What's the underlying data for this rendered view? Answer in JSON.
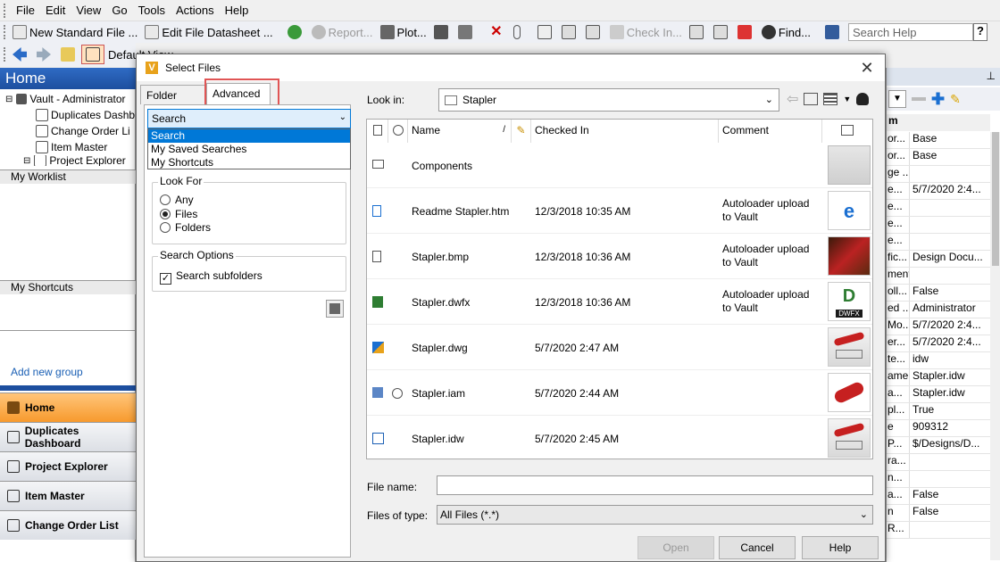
{
  "menu": [
    "File",
    "Edit",
    "View",
    "Go",
    "Tools",
    "Actions",
    "Help"
  ],
  "toolbar1": {
    "new_standard_file": "New Standard File ...",
    "edit_file_datasheet": "Edit File Datasheet ...",
    "report": "Report...",
    "plot": "Plot...",
    "check_in": "Check In...",
    "find": "Find...",
    "search_help_placeholder": "Search Help",
    "help_q": "?"
  },
  "toolbar2": {
    "view_label": "Default View"
  },
  "left_pane": {
    "title": "Home",
    "tree": [
      "Vault - Administrator",
      "Duplicates Dashb",
      "Change Order Li",
      "Item Master",
      "Project Explorer"
    ],
    "my_worklist": "My Worklist",
    "my_shortcuts": "My Shortcuts",
    "add_new_group": "Add new group",
    "nav": [
      "Home",
      "Duplicates Dashboard",
      "Project Explorer",
      "Item Master",
      "Change Order List"
    ]
  },
  "dialog": {
    "title": "Select Files",
    "close": "✕",
    "tabs": [
      "Folder View",
      "Advanced"
    ],
    "search_combo": "Search",
    "search_options_list": [
      "Search",
      "My Saved Searches",
      "My Shortcuts"
    ],
    "look_for": {
      "title": "Look For",
      "options": [
        "Any",
        "Files",
        "Folders"
      ],
      "selected": "Files"
    },
    "search_options": {
      "title": "Search Options",
      "subfolders": "Search subfolders",
      "checked": true
    },
    "look_in_label": "Look in:",
    "look_in_value": "Stapler",
    "columns": [
      "Name",
      "Checked In",
      "Comment"
    ],
    "files": [
      {
        "name": "Components",
        "checked_in": "",
        "comment": [
          "",
          ""
        ],
        "icon": "folder-icon",
        "thumb": "folder"
      },
      {
        "name": "Readme Stapler.htm",
        "checked_in": "12/3/2018 10:35 AM",
        "comment": [
          "Autoloader upload",
          "to Vault"
        ],
        "icon": "htm-file-icon",
        "thumb": "edge"
      },
      {
        "name": "Stapler.bmp",
        "checked_in": "12/3/2018 10:36 AM",
        "comment": [
          "Autoloader upload",
          "to Vault"
        ],
        "icon": "bmp-file-icon",
        "thumb": "stapler-render"
      },
      {
        "name": "Stapler.dwfx",
        "checked_in": "12/3/2018 10:36 AM",
        "comment": [
          "Autoloader upload",
          "to Vault"
        ],
        "icon": "dwfx-file-icon",
        "thumb": "dwfx"
      },
      {
        "name": "Stapler.dwg",
        "checked_in": "5/7/2020 2:47 AM",
        "comment": [
          "",
          ""
        ],
        "icon": "dwg-file-icon",
        "thumb": "drawing"
      },
      {
        "name": "Stapler.iam",
        "checked_in": "5/7/2020 2:44 AM",
        "comment": [
          "",
          ""
        ],
        "icon": "iam-file-icon",
        "thumb": "stapler-red"
      },
      {
        "name": "Stapler.idw",
        "checked_in": "5/7/2020 2:45 AM",
        "comment": [
          "",
          ""
        ],
        "icon": "idw-file-icon",
        "thumb": "drawing"
      }
    ],
    "file_name_label": "File name:",
    "file_name_value": "",
    "files_of_type_label": "Files of type:",
    "files_of_type_value": "All Files (*.*)",
    "buttons": {
      "open": "Open",
      "cancel": "Cancel",
      "help": "Help"
    }
  },
  "right_pane": {
    "header": "m",
    "rows": [
      [
        "or...",
        "Base"
      ],
      [
        "or...",
        "Base"
      ],
      [
        "ge ...",
        ""
      ],
      [
        "e...",
        "5/7/2020 2:4..."
      ],
      [
        "e...",
        ""
      ],
      [
        "e...",
        ""
      ],
      [
        "e...",
        ""
      ],
      [
        "fic...",
        "Design Docu..."
      ],
      [
        "ment",
        ""
      ],
      [
        "oll...",
        "False"
      ],
      [
        "ed ...",
        "Administrator"
      ],
      [
        "Mo...",
        "5/7/2020 2:4..."
      ],
      [
        "er...",
        "5/7/2020 2:4..."
      ],
      [
        "te...",
        "idw"
      ],
      [
        "ame",
        "Stapler.idw"
      ],
      [
        "a...",
        "Stapler.idw"
      ],
      [
        "pl...",
        "True"
      ],
      [
        "e",
        "909312"
      ],
      [
        "P...",
        "$/Designs/D..."
      ],
      [
        "ra...",
        ""
      ],
      [
        "n...",
        ""
      ],
      [
        "a...",
        "False"
      ],
      [
        "n",
        "False"
      ],
      [
        "R...",
        ""
      ]
    ]
  },
  "colors": {
    "accent": "#0078d7",
    "nav_active": "#f79a2d",
    "highlight_box": "#e05555",
    "home_header": "#1d4f9f"
  }
}
